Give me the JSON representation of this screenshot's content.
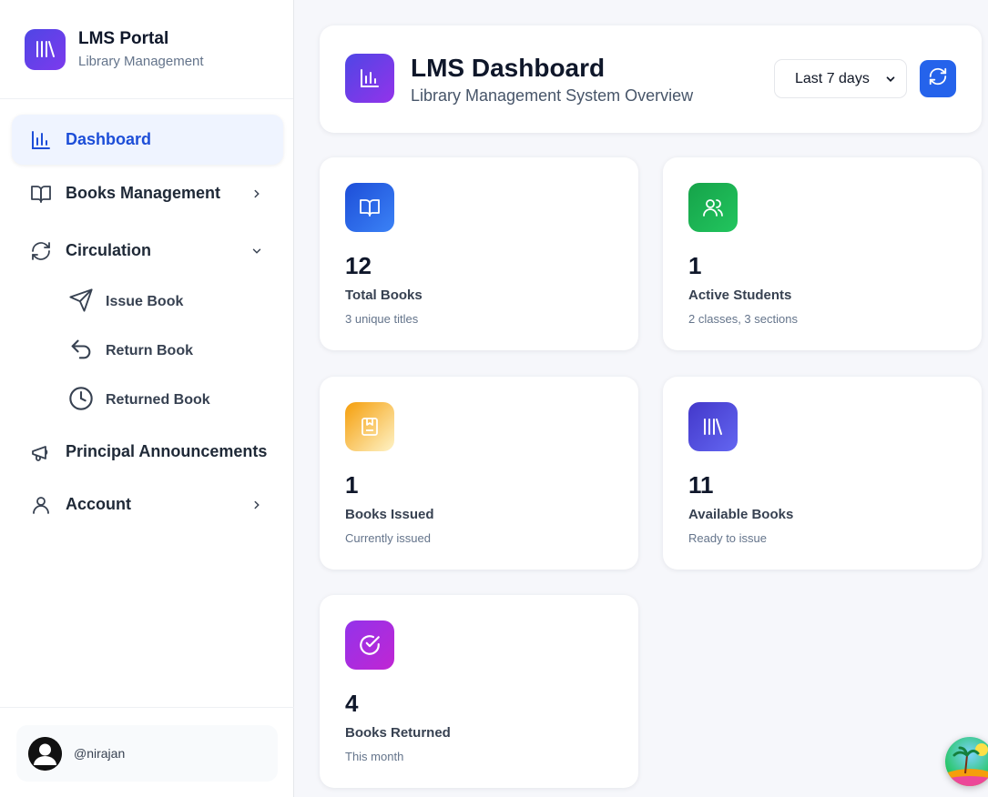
{
  "brand": {
    "title": "LMS Portal",
    "subtitle": "Library Management"
  },
  "nav": {
    "dashboard": "Dashboard",
    "books_management": "Books Management",
    "circulation": "Circulation",
    "issue_book": "Issue Book",
    "return_book": "Return Book",
    "returned_book": "Returned Book",
    "announcements": "Principal Announcements",
    "account": "Account"
  },
  "user": {
    "handle": "@nirajan"
  },
  "header": {
    "title": "LMS Dashboard",
    "subtitle": "Library Management System Overview",
    "range": "Last 7 days"
  },
  "stats": [
    {
      "value": "12",
      "label": "Total Books",
      "sub": "3 unique titles",
      "color": "#2563eb",
      "icon": "book-open-icon"
    },
    {
      "value": "1",
      "label": "Active Students",
      "sub": "2 classes, 3 sections",
      "color": "#16a34a",
      "icon": "users-icon"
    },
    {
      "value": "1",
      "label": "Books Issued",
      "sub": "Currently issued",
      "color": "#f59e0b",
      "icon": "bookmark-book-icon"
    },
    {
      "value": "11",
      "label": "Available Books",
      "sub": "Ready to issue",
      "color": "#4f46e5",
      "icon": "library-icon"
    },
    {
      "value": "4",
      "label": "Books Returned",
      "sub": "This month",
      "color": "#9333ea",
      "icon": "check-circle-icon"
    }
  ],
  "colors": {
    "accent": "#2563eb",
    "active_nav_bg": "#eff4ff"
  }
}
